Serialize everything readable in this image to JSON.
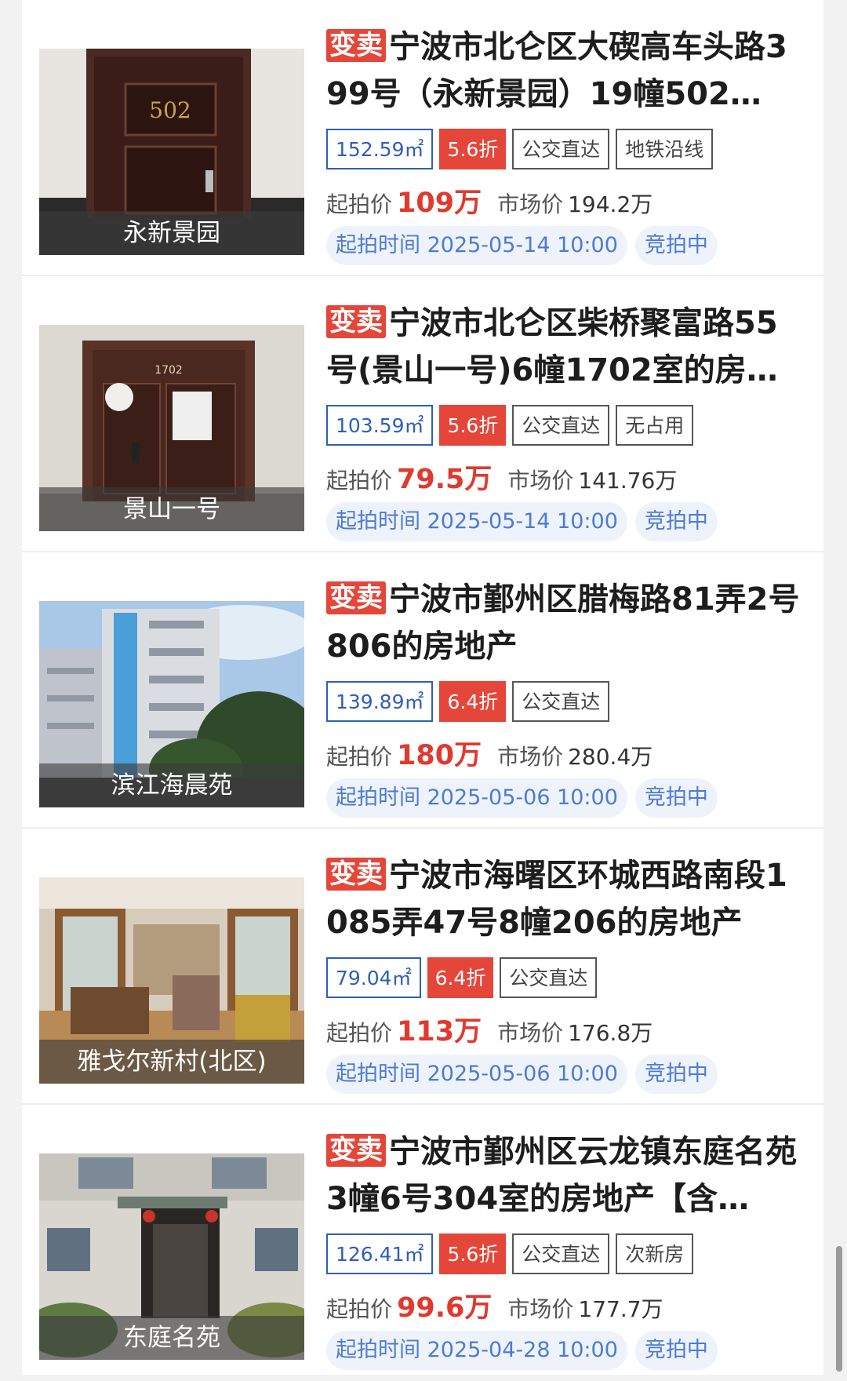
{
  "listings": [
    {
      "badge": "变卖",
      "title": "宁波市北仑区大碶高车头路399号（永新景园）19幢502…",
      "caption": "永新景园",
      "area": "152.59㎡",
      "discount": "5.6折",
      "tags": [
        "公交直达",
        "地铁沿线"
      ],
      "start_label": "起拍价",
      "start_price": "109万",
      "market_label": "市场价",
      "market_price": "194.2万",
      "time_text": "起拍时间 2025-05-14 10:00",
      "status": "竞拍中"
    },
    {
      "badge": "变卖",
      "title": "宁波市北仑区柴桥聚富路55号(景山一号)6幢1702室的房地…",
      "caption": "景山一号",
      "area": "103.59㎡",
      "discount": "5.6折",
      "tags": [
        "公交直达",
        "无占用"
      ],
      "start_label": "起拍价",
      "start_price": "79.5万",
      "market_label": "市场价",
      "market_price": "141.76万",
      "time_text": "起拍时间 2025-05-14 10:00",
      "status": "竞拍中"
    },
    {
      "badge": "变卖",
      "title": "宁波市鄞州区腊梅路81弄2号806的房地产",
      "caption": "滨江海晨苑",
      "area": "139.89㎡",
      "discount": "6.4折",
      "tags": [
        "公交直达"
      ],
      "start_label": "起拍价",
      "start_price": "180万",
      "market_label": "市场价",
      "market_price": "280.4万",
      "time_text": "起拍时间 2025-05-06 10:00",
      "status": "竞拍中"
    },
    {
      "badge": "变卖",
      "title": "宁波市海曙区环城西路南段1085弄47号8幢206的房地产",
      "caption": "雅戈尔新村(北区)",
      "area": "79.04㎡",
      "discount": "6.4折",
      "tags": [
        "公交直达"
      ],
      "start_label": "起拍价",
      "start_price": "113万",
      "market_label": "市场价",
      "market_price": "176.8万",
      "time_text": "起拍时间 2025-05-06 10:00",
      "status": "竞拍中"
    },
    {
      "badge": "变卖",
      "title": "宁波市鄞州区云龙镇东庭名苑3幢6号304室的房地产【含…",
      "caption": "东庭名苑",
      "area": "126.41㎡",
      "discount": "5.6折",
      "tags": [
        "公交直达",
        "次新房"
      ],
      "start_label": "起拍价",
      "start_price": "99.6万",
      "market_label": "市场价",
      "market_price": "177.7万",
      "time_text": "起拍时间 2025-04-28 10:00",
      "status": "竞拍中"
    }
  ],
  "images": [
    {
      "kind": "door",
      "door_number": "502"
    },
    {
      "kind": "door",
      "door_number": "1702"
    },
    {
      "kind": "building"
    },
    {
      "kind": "room"
    },
    {
      "kind": "entrance"
    }
  ],
  "colors": {
    "badge": "#e5463a",
    "start_price": "#e03a2f",
    "area_tag": "#2e5fb8",
    "pill_bg": "#eef3fb",
    "pill_text": "#4d7bd2"
  }
}
